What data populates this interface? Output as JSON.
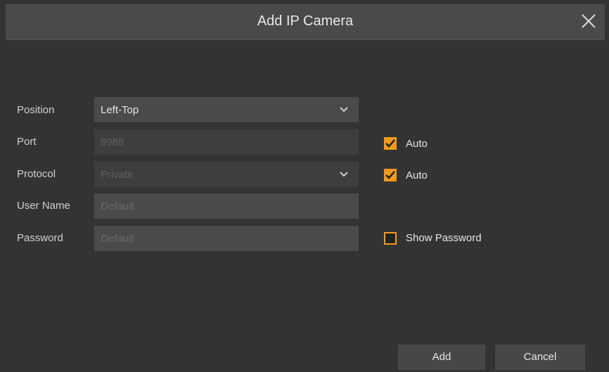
{
  "dialog": {
    "title": "Add IP Camera",
    "accent_color": "#f39a1c"
  },
  "form": {
    "position": {
      "label": "Position",
      "value": "Left-Top"
    },
    "port": {
      "label": "Port",
      "value": "9988",
      "auto_label": "Auto",
      "auto_checked": true
    },
    "protocol": {
      "label": "Protocol",
      "value": "Private",
      "auto_label": "Auto",
      "auto_checked": true
    },
    "user_name": {
      "label": "User Name",
      "placeholder": "Default"
    },
    "password": {
      "label": "Password",
      "placeholder": "Default",
      "show_label": "Show Password",
      "show_checked": false
    }
  },
  "buttons": {
    "add": "Add",
    "cancel": "Cancel"
  },
  "icons": {
    "close": "close-icon",
    "dropdown": "chevron-down-icon",
    "check": "checkmark-icon"
  }
}
